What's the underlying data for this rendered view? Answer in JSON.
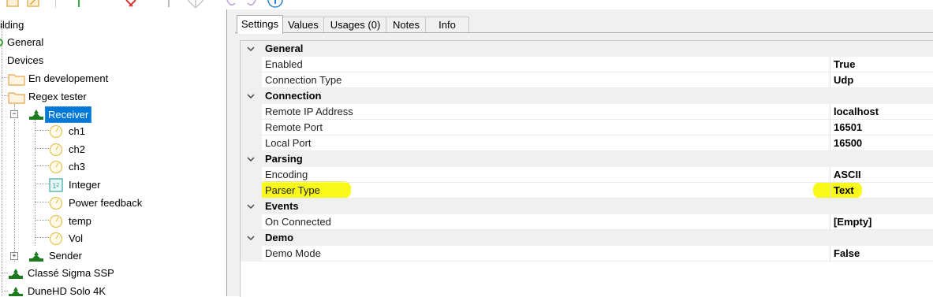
{
  "toolbar": {
    "icons": [
      "new-icon",
      "edit-icon",
      "add-icon",
      "delete-icon",
      "move-icon",
      "diamond-icon",
      "undo-icon",
      "redo-icon",
      "info-icon"
    ]
  },
  "tree": {
    "root_label": "ilding",
    "items": [
      {
        "label": "General",
        "icon": "gear-icon"
      },
      {
        "label": "Devices",
        "icon": "none"
      },
      {
        "label": "En developement",
        "icon": "folder-icon"
      },
      {
        "label": "Regex tester",
        "icon": "folder-icon"
      },
      {
        "label": "Receiver",
        "icon": "device-icon",
        "selected": true
      },
      {
        "label": "ch1",
        "icon": "channel-icon"
      },
      {
        "label": "ch2",
        "icon": "channel-icon"
      },
      {
        "label": "ch3",
        "icon": "channel-icon"
      },
      {
        "label": "Integer",
        "icon": "integer-icon"
      },
      {
        "label": "Power feedback",
        "icon": "channel-icon"
      },
      {
        "label": "temp",
        "icon": "channel-icon"
      },
      {
        "label": "Vol",
        "icon": "channel-icon"
      },
      {
        "label": "Sender",
        "icon": "device-icon"
      },
      {
        "label": "Classé Sigma SSP",
        "icon": "device-icon"
      },
      {
        "label": "DuneHD Solo 4K",
        "icon": "device-icon"
      }
    ]
  },
  "tabs": [
    {
      "label": "Settings",
      "active": true
    },
    {
      "label": "Values"
    },
    {
      "label": "Usages (0)"
    },
    {
      "label": "Notes"
    },
    {
      "label": "Info"
    }
  ],
  "grid": {
    "categories": [
      {
        "label": "General",
        "props": [
          {
            "name": "Enabled",
            "value": "True"
          },
          {
            "name": "Connection Type",
            "value": "Udp"
          }
        ]
      },
      {
        "label": "Connection",
        "props": [
          {
            "name": "Remote IP Address",
            "value": "localhost"
          },
          {
            "name": "Remote Port",
            "value": "16501"
          },
          {
            "name": "Local Port",
            "value": "16500"
          }
        ]
      },
      {
        "label": "Parsing",
        "props": [
          {
            "name": "Encoding",
            "value": "ASCII"
          },
          {
            "name": "Parser Type",
            "value": "Text",
            "highlighted": true
          }
        ]
      },
      {
        "label": "Events",
        "props": [
          {
            "name": "On Connected",
            "value": "[Empty]"
          }
        ]
      },
      {
        "label": "Demo",
        "props": [
          {
            "name": "Demo Mode",
            "value": "False"
          }
        ]
      }
    ]
  },
  "colors": {
    "selection": "#0078d7",
    "highlight": "#f7f700",
    "device_green": "#1e7a1e",
    "folder": "#f2c27a",
    "channel": "#e8c45a"
  }
}
